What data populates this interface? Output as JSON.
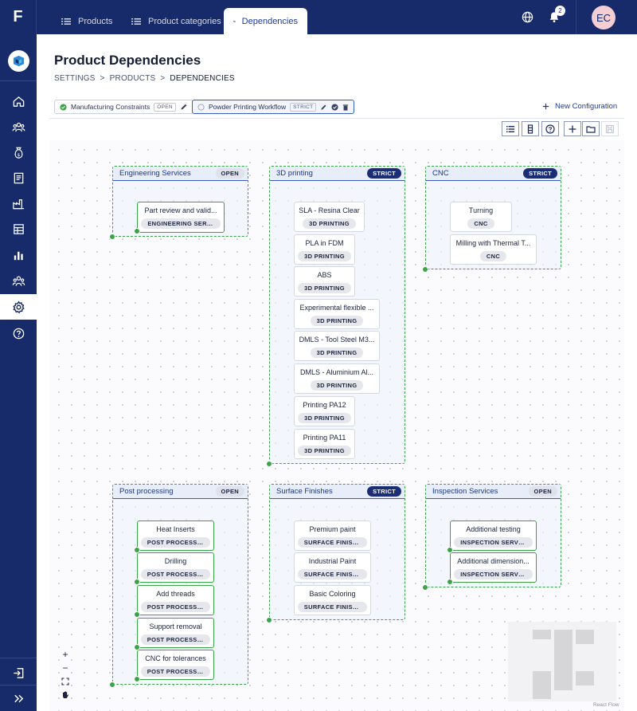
{
  "app": {
    "logo_letter": "F"
  },
  "topbar": {
    "tabs": [
      {
        "label": "Products",
        "icon": "list-icon"
      },
      {
        "label": "Product categories",
        "icon": "list-icon"
      },
      {
        "label": "Dependencies",
        "icon": "hierarchy-icon",
        "active": true
      }
    ],
    "notification_count": "2",
    "avatar_initials": "EC"
  },
  "sidebar": {
    "items": [
      {
        "name": "home-icon"
      },
      {
        "name": "users-icon"
      },
      {
        "name": "money-bag-icon"
      },
      {
        "name": "document-icon"
      },
      {
        "name": "factory-icon"
      },
      {
        "name": "table-icon"
      },
      {
        "name": "bar-chart-icon"
      },
      {
        "name": "team-icon"
      },
      {
        "name": "gear-icon",
        "active": true
      },
      {
        "name": "help-icon"
      }
    ]
  },
  "page": {
    "title": "Product Dependencies",
    "breadcrumb": [
      "SETTINGS",
      ">",
      "PRODUCTS",
      ">",
      "DEPENDENCIES"
    ]
  },
  "configurations": [
    {
      "label": "Manufacturing Constraints",
      "badge": "OPEN"
    },
    {
      "label": "Powder Printing Workflow",
      "badge": "STRICT",
      "selected": true
    }
  ],
  "new_config_label": "New Configuration",
  "groups": [
    {
      "title": "Engineering Services",
      "mode": "OPEN",
      "nodes": [
        {
          "title": "Part review and valid...",
          "tag": "ENGINEERING SERVI..."
        }
      ]
    },
    {
      "title": "3D printing",
      "mode": "STRICT",
      "nodes": [
        {
          "title": "SLA - Resina Clear",
          "tag": "3D PRINTING"
        },
        {
          "title": "PLA in FDM",
          "tag": "3D PRINTING"
        },
        {
          "title": "ABS",
          "tag": "3D PRINTING"
        },
        {
          "title": "Experimental flexible ...",
          "tag": "3D PRINTING"
        },
        {
          "title": "DMLS - Tool Steel M3...",
          "tag": "3D PRINTING"
        },
        {
          "title": "DMLS - Aluminium Al...",
          "tag": "3D PRINTING"
        },
        {
          "title": "Printing PA12",
          "tag": "3D PRINTING"
        },
        {
          "title": "Printing PA11",
          "tag": "3D PRINTING"
        }
      ]
    },
    {
      "title": "CNC",
      "mode": "STRICT",
      "nodes": [
        {
          "title": "Turning",
          "tag": "CNC"
        },
        {
          "title": "Milling with Thermal T...",
          "tag": "CNC"
        }
      ]
    },
    {
      "title": "Post processing",
      "mode": "OPEN",
      "nodes": [
        {
          "title": "Heat Inserts",
          "tag": "POST PROCESSING"
        },
        {
          "title": "Drilling",
          "tag": "POST PROCESSING"
        },
        {
          "title": "Add threads",
          "tag": "POST PROCESSING"
        },
        {
          "title": "Support removal",
          "tag": "POST PROCESSING"
        },
        {
          "title": "CNC for tolerances",
          "tag": "POST PROCESSING"
        }
      ]
    },
    {
      "title": "Surface Finishes",
      "mode": "STRICT",
      "nodes": [
        {
          "title": "Premium paint",
          "tag": "SURFACE FINISHES"
        },
        {
          "title": "Industrial Paint",
          "tag": "SURFACE FINISHES"
        },
        {
          "title": "Basic Coloring",
          "tag": "SURFACE FINISHES"
        }
      ]
    },
    {
      "title": "Inspection Services",
      "mode": "OPEN",
      "nodes": [
        {
          "title": "Additional testing",
          "tag": "INSPECTION SERVIC..."
        },
        {
          "title": "Additional dimension...",
          "tag": "INSPECTION SERVIC..."
        }
      ]
    }
  ],
  "zoom_controls": [
    "+",
    "−"
  ],
  "attribution": "React Flow",
  "colors": {
    "navy": "#172a6a",
    "accent": "#1f3a9c",
    "connector_green": "#3aa346"
  }
}
